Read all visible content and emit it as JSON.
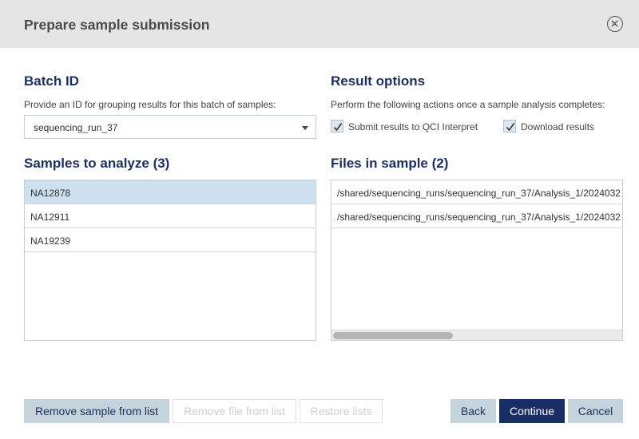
{
  "dialog": {
    "title": "Prepare sample submission",
    "close_icon": "close-circle-icon"
  },
  "batch": {
    "title": "Batch ID",
    "description": "Provide an ID for grouping results for this batch of samples:",
    "selected_value": "sequencing_run_37"
  },
  "result_options": {
    "title": "Result options",
    "description": "Perform the following actions once a sample analysis completes:",
    "options": [
      {
        "label": "Submit results to QCI Interpret",
        "checked": true
      },
      {
        "label": "Download results",
        "checked": true
      }
    ]
  },
  "samples": {
    "title": "Samples to analyze (3)",
    "items": [
      "NA12878",
      "NA12911",
      "NA19239"
    ],
    "selected": "NA12878"
  },
  "files": {
    "title": "Files in sample (2)",
    "items": [
      "/shared/sequencing_runs/sequencing_run_37/Analysis_1/2024032",
      "/shared/sequencing_runs/sequencing_run_37/Analysis_1/2024032"
    ]
  },
  "buttons": {
    "remove_sample": "Remove sample from list",
    "remove_file": "Remove file from list",
    "restore": "Restore lists",
    "back": "Back",
    "continue": "Continue",
    "cancel": "Cancel"
  },
  "colors": {
    "accent": "#1a2e66",
    "heading": "#1e2f5e",
    "secondary_button": "#c5d3dd",
    "selected_row": "#cde0f0",
    "header_bg": "#e5e5e5"
  }
}
